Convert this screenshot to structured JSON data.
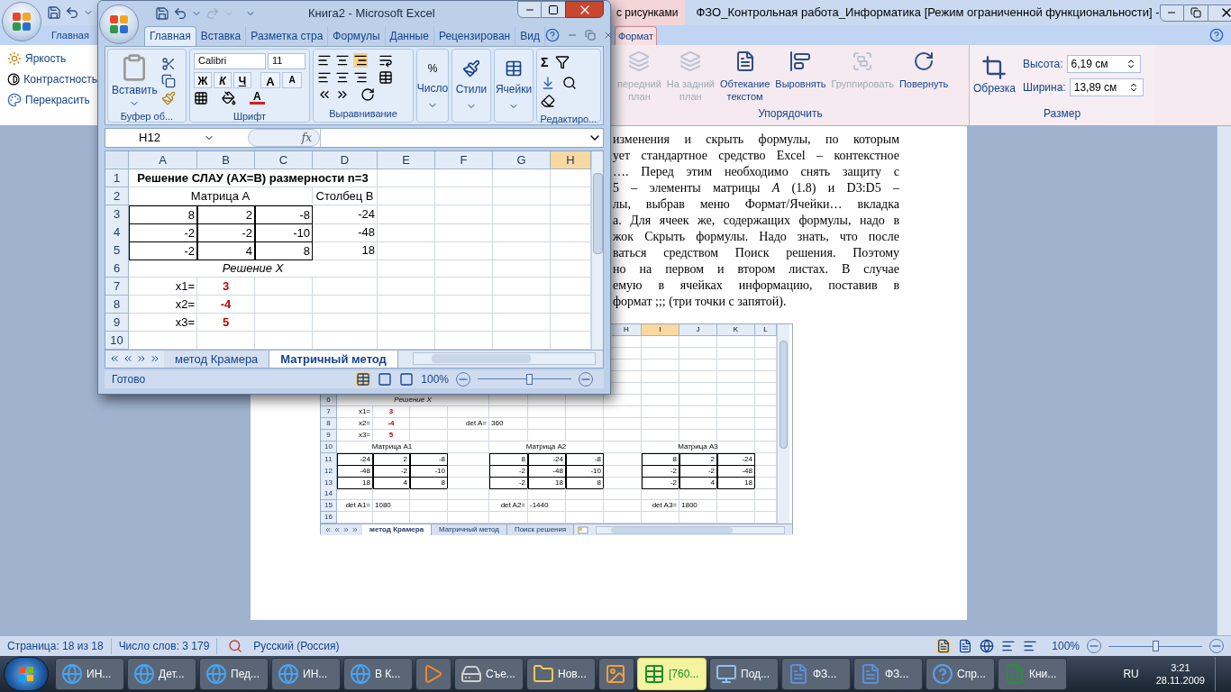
{
  "word": {
    "title_context": "с рисунками",
    "title": "ФЗО_Контрольная работа_Информатика [Режим ограниченной функциональности] -",
    "tabs": [
      {
        "label": "Главная",
        "selected": false
      },
      {
        "label": "Формат",
        "selected": true
      }
    ],
    "adjust": [
      {
        "label": "Яркость",
        "kind": "brightness"
      },
      {
        "label": "Контрастность",
        "kind": "contrast"
      },
      {
        "label": "Перекрасить",
        "kind": "recolor"
      }
    ],
    "arrange": {
      "label": "Упорядочить",
      "buttons": [
        {
          "label": "передний\nплан",
          "kind": "front",
          "disabled": true
        },
        {
          "label": "На задний\nплан",
          "kind": "back",
          "disabled": true
        },
        {
          "label": "Обтекание\nтекстом",
          "kind": "wrap",
          "disabled": false
        },
        {
          "label": "Выровнять",
          "kind": "align",
          "disabled": false
        },
        {
          "label": "Группировать",
          "kind": "group",
          "disabled": true
        },
        {
          "label": "Повернуть",
          "kind": "rotate",
          "disabled": false
        }
      ]
    },
    "size": {
      "label": "Размер",
      "crop": "Обрезка",
      "height_label": "Высота:",
      "height": "6,19 см",
      "width_label": "Ширина:",
      "width": "13,89 см"
    },
    "document_lines": [
      "изменения и скрыть формулы, по которым",
      "ует стандартное средство Excel – контекстное",
      "…. Перед этим необходимо снять защиту с",
      "5 – элементы матрицы *A* (1.8) и D3:D5 –",
      "лы, выбрав меню Формат/Ячейки… вкладка",
      "а. Для ячеек же, содержащих формулы, надо в",
      "жок Скрыть формулы. Надо знать, что после",
      "ваться средством Поиск решения. Поэтому",
      "но на первом и втором листах. В случае",
      "емую в ячейках информацию, поставив в",
      "формат ;;; (три точки с запятой)."
    ],
    "embedded_sheet": {
      "columns": [
        {
          "label": "H",
          "selected": false
        },
        {
          "label": "I",
          "selected": true
        },
        {
          "label": "J",
          "selected": false
        },
        {
          "label": "K",
          "selected": false
        },
        {
          "label": "L",
          "selected": false
        }
      ],
      "rows": [
        {
          "num": "6",
          "cells": {
            "A": {
              "text": "Решение X",
              "kind": "italic"
            }
          }
        },
        {
          "num": "7",
          "cells": {
            "A": {
              "text": "x1=",
              "kind": "number"
            },
            "B": {
              "text": "3",
              "kind": "result"
            }
          }
        },
        {
          "num": "8",
          "cells": {
            "A": {
              "text": "x2=",
              "kind": "number"
            },
            "B": {
              "text": "-4",
              "kind": "result"
            },
            "D": {
              "text": "det A=",
              "kind": "number"
            },
            "E": {
              "text": "360",
              "kind": "left"
            }
          }
        },
        {
          "num": "9",
          "cells": {
            "A": {
              "text": "x3=",
              "kind": "number"
            },
            "B": {
              "text": "5",
              "kind": "result"
            }
          }
        },
        {
          "num": "10",
          "cells": {
            "A": {
              "text": "Матрица A1",
              "kind": "caption"
            },
            "E": {
              "text": "Матрица A2",
              "kind": "caption"
            },
            "I": {
              "text": "Матрица A3",
              "kind": "caption"
            }
          }
        },
        {
          "num": "11",
          "cells": {
            "A": {
              "text": "-24",
              "kind": "boxed"
            },
            "B": {
              "text": "2",
              "kind": "boxed"
            },
            "C": {
              "text": "-8",
              "kind": "boxed"
            },
            "E": {
              "text": "8",
              "kind": "boxed"
            },
            "F": {
              "text": "-24",
              "kind": "boxed"
            },
            "G": {
              "text": "-8",
              "kind": "boxed"
            },
            "I": {
              "text": "8",
              "kind": "boxed"
            },
            "J": {
              "text": "2",
              "kind": "boxed"
            },
            "K": {
              "text": "-24",
              "kind": "boxed"
            }
          }
        },
        {
          "num": "12",
          "cells": {
            "A": {
              "text": "-48",
              "kind": "boxed"
            },
            "B": {
              "text": "-2",
              "kind": "boxed"
            },
            "C": {
              "text": "-10",
              "kind": "boxed"
            },
            "E": {
              "text": "-2",
              "kind": "boxed"
            },
            "F": {
              "text": "-48",
              "kind": "boxed"
            },
            "G": {
              "text": "-10",
              "kind": "boxed"
            },
            "I": {
              "text": "-2",
              "kind": "boxed"
            },
            "J": {
              "text": "-2",
              "kind": "boxed"
            },
            "K": {
              "text": "-48",
              "kind": "boxed"
            }
          }
        },
        {
          "num": "13",
          "cells": {
            "A": {
              "text": "18",
              "kind": "boxed"
            },
            "B": {
              "text": "4",
              "kind": "boxed"
            },
            "C": {
              "text": "8",
              "kind": "boxed"
            },
            "E": {
              "text": "-2",
              "kind": "boxed"
            },
            "F": {
              "text": "18",
              "kind": "boxed"
            },
            "G": {
              "text": "8",
              "kind": "boxed"
            },
            "I": {
              "text": "-2",
              "kind": "boxed"
            },
            "J": {
              "text": "4",
              "kind": "boxed"
            },
            "K": {
              "text": "18",
              "kind": "boxed"
            }
          }
        },
        {
          "num": "14"
        },
        {
          "num": "15",
          "cells": {
            "A": {
              "text": "det A1=",
              "kind": "number"
            },
            "B": {
              "text": "1080",
              "kind": "left"
            },
            "E": {
              "text": "det A2=",
              "kind": "number"
            },
            "F": {
              "text": "-1440",
              "kind": "left"
            },
            "I": {
              "text": "det A3=",
              "kind": "number"
            },
            "J": {
              "text": "1800",
              "kind": "left"
            }
          }
        },
        {
          "num": "16"
        }
      ],
      "sheet_tabs": [
        {
          "label": "метод Крамера",
          "selected": true
        },
        {
          "label": "Матричный метод",
          "selected": false
        },
        {
          "label": "Поиск решения",
          "selected": false
        }
      ]
    },
    "status_bar": {
      "page": "Страница: 18 из 18",
      "words": "Число слов: 3 179",
      "language": "Русский (Россия)",
      "zoom": "100%",
      "level": 0.5
    }
  },
  "excel": {
    "title": "Книга2 - Microsoft Excel",
    "tabs": [
      {
        "label": "Главная",
        "selected": true
      },
      {
        "label": "Вставка",
        "selected": false
      },
      {
        "label": "Разметка стра",
        "selected": false
      },
      {
        "label": "Формулы",
        "selected": false
      },
      {
        "label": "Данные",
        "selected": false
      },
      {
        "label": "Рецензирован",
        "selected": false
      },
      {
        "label": "Вид",
        "selected": false
      }
    ],
    "clipboard": {
      "paste": "Вставить",
      "label": "Буфер об..."
    },
    "font": {
      "name": "Calibri",
      "size": "11",
      "bold": "Ж",
      "italic": "К",
      "underline": "Ч",
      "grow": "A",
      "shrink": "A",
      "font_color_letter": "A",
      "label": "Шрифт"
    },
    "alignment": {
      "label": "Выравнивание"
    },
    "number": {
      "symbol": "%",
      "label": "Число"
    },
    "styles": {
      "label": "Стили"
    },
    "cells": {
      "label": "Ячейки"
    },
    "editing": {
      "symbol": "Σ",
      "label": "Редактиро..."
    },
    "name_box": "H12",
    "fx": "fx",
    "columns": [
      {
        "label": "A",
        "selected": false
      },
      {
        "label": "B",
        "selected": false
      },
      {
        "label": "C",
        "selected": false
      },
      {
        "label": "D",
        "selected": false
      },
      {
        "label": "E",
        "selected": false
      },
      {
        "label": "F",
        "selected": false
      },
      {
        "label": "G",
        "selected": false
      },
      {
        "label": "H",
        "selected": true
      }
    ],
    "rows": [
      {
        "num": "1",
        "cells": {
          "A": {
            "text": "Решение СЛАУ (AX=B) размерности n=3",
            "kind": "heading"
          }
        }
      },
      {
        "num": "2",
        "cells": {
          "A": {
            "text": "Матрица A",
            "kind": "caption"
          },
          "D": {
            "text": "Столбец B",
            "kind": "label"
          }
        }
      },
      {
        "num": "3",
        "cells": {
          "A": {
            "text": "8",
            "kind": "boxed"
          },
          "B": {
            "text": "2",
            "kind": "boxed"
          },
          "C": {
            "text": "-8",
            "kind": "boxed"
          },
          "D": {
            "text": "-24",
            "kind": "number"
          }
        }
      },
      {
        "num": "4",
        "cells": {
          "A": {
            "text": "-2",
            "kind": "boxed"
          },
          "B": {
            "text": "-2",
            "kind": "boxed"
          },
          "C": {
            "text": "-10",
            "kind": "boxed"
          },
          "D": {
            "text": "-48",
            "kind": "number"
          }
        }
      },
      {
        "num": "5",
        "cells": {
          "A": {
            "text": "-2",
            "kind": "boxed"
          },
          "B": {
            "text": "4",
            "kind": "boxed"
          },
          "C": {
            "text": "8",
            "kind": "boxed"
          },
          "D": {
            "text": "18",
            "kind": "number"
          }
        }
      },
      {
        "num": "6",
        "cells": {
          "A": {
            "text": "Решение X",
            "kind": "italic"
          }
        }
      },
      {
        "num": "7",
        "cells": {
          "A": {
            "text": "x1=",
            "kind": "number"
          },
          "B": {
            "text": "3",
            "kind": "result"
          }
        }
      },
      {
        "num": "8",
        "cells": {
          "A": {
            "text": "x2=",
            "kind": "number"
          },
          "B": {
            "text": "-4",
            "kind": "result"
          }
        }
      },
      {
        "num": "9",
        "cells": {
          "A": {
            "text": "x3=",
            "kind": "number"
          },
          "B": {
            "text": "5",
            "kind": "result"
          }
        }
      },
      {
        "num": "10"
      }
    ],
    "sheet_tabs": [
      {
        "label": "метод Крамера",
        "selected": false
      },
      {
        "label": "Матричный метод",
        "selected": true
      }
    ],
    "status_bar": {
      "state": "Готово",
      "zoom": "100%",
      "level": 0.55
    }
  },
  "taskbar": {
    "items": [
      {
        "label": "ИН...",
        "kind": "browser",
        "selected": false
      },
      {
        "label": "Дет...",
        "kind": "browser",
        "selected": false
      },
      {
        "label": "Пед...",
        "kind": "browser",
        "selected": false
      },
      {
        "label": "ИН...",
        "kind": "browser",
        "selected": false
      },
      {
        "label": "В К...",
        "kind": "browser",
        "selected": false
      },
      {
        "kind": "media",
        "selected": false
      },
      {
        "label": "Съе...",
        "kind": "drive",
        "selected": false
      },
      {
        "label": "Нов...",
        "kind": "folder",
        "selected": false
      },
      {
        "kind": "screen",
        "selected": false
      },
      {
        "label": "[760...",
        "kind": "app",
        "selected": true
      },
      {
        "label": "Под...",
        "kind": "monitor",
        "selected": false
      },
      {
        "label": "ФЗ...",
        "kind": "word",
        "selected": false
      },
      {
        "label": "ФЗ...",
        "kind": "word",
        "selected": false
      },
      {
        "label": "Спр...",
        "kind": "help",
        "selected": false
      },
      {
        "label": "Кни...",
        "kind": "excel",
        "selected": false
      }
    ],
    "language": "RU",
    "time": "3:21",
    "date": "28.11.2009"
  }
}
